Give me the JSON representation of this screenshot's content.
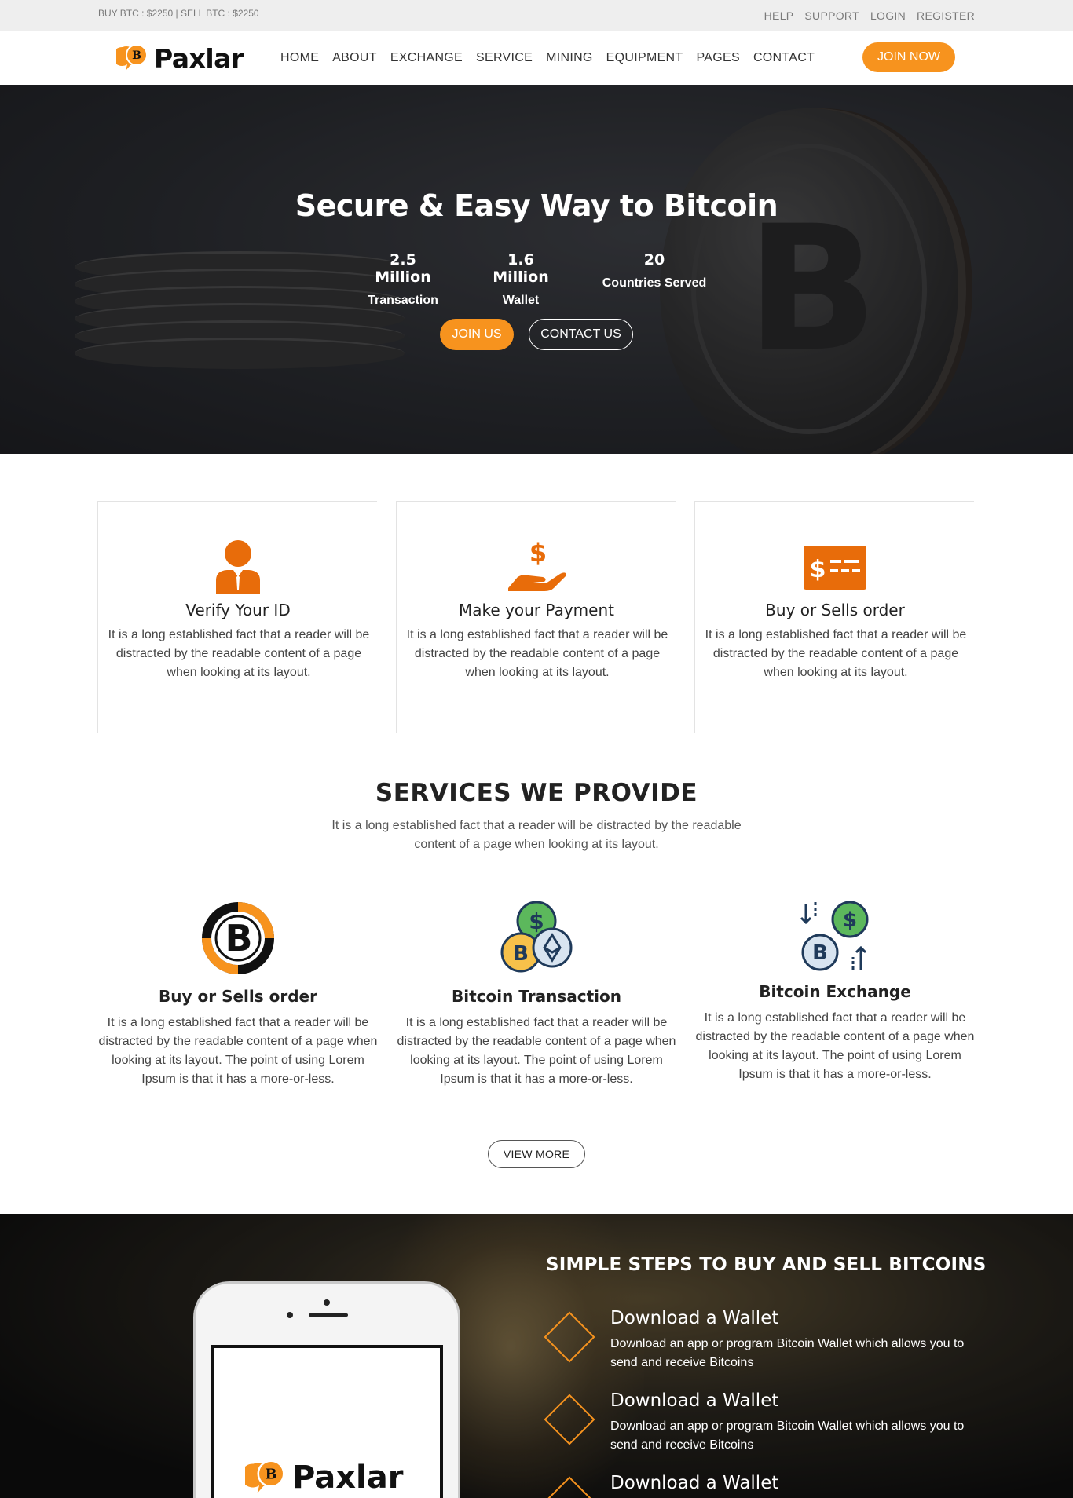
{
  "topbar": {
    "prices": "BUY BTC : $2250 | SELL BTC : $2250",
    "links": [
      "HELP",
      "SUPPORT",
      "LOGIN",
      "REGISTER"
    ]
  },
  "nav": {
    "logo_text": "Paxlar",
    "logo_letter": "B",
    "menu": [
      "HOME",
      "ABOUT",
      "EXCHANGE",
      "SERVICE",
      "MINING",
      "EQUIPMENT",
      "PAGES",
      "CONTACT"
    ],
    "cta": "JOIN NOW"
  },
  "hero": {
    "title": "Secure & Easy Way to Bitcoin",
    "stats": [
      {
        "value": "2.5 Million",
        "label": "Transaction"
      },
      {
        "value": "1.6 Million",
        "label": "Wallet"
      },
      {
        "value": "20",
        "label": "Countries Served"
      }
    ],
    "join_label": "JOIN US",
    "contact_label": "CONTACT US"
  },
  "features": [
    {
      "icon": "user-id-icon",
      "title": "Verify Your ID",
      "text": "It is a long established fact that a reader will be distracted by the readable content of a page when looking at its layout."
    },
    {
      "icon": "payment-hand-icon",
      "title": "Make your Payment",
      "text": "It is a long established fact that a reader will be distracted by the readable content of a page when looking at its layout."
    },
    {
      "icon": "dollar-card-icon",
      "title": "Buy or Sells order",
      "text": "It is a long established fact that a reader will be distracted by the readable content of a page when looking at its layout."
    }
  ],
  "services": {
    "title": "SERVICES WE PROVIDE",
    "subtitle": "It is a long established fact that a reader will be distracted by the readable content of a page when looking at its layout.",
    "items": [
      {
        "icon": "bitcoin-coin-icon",
        "title": "Buy or Sells order",
        "text": "It is a long established fact that a reader will be distracted by the readable content of a page when looking at its layout. The point of using Lorem Ipsum is that it has a more-or-less."
      },
      {
        "icon": "coins-stack-icon",
        "title": "Bitcoin Transaction",
        "text": "It is a long established fact that a reader will be distracted by the readable content of a page when looking at its layout. The point of using Lorem Ipsum is that it has a more-or-less."
      },
      {
        "icon": "exchange-icon",
        "title": "Bitcoin Exchange",
        "text": "It is a long established fact that a reader will be distracted by the readable content of a page when looking at its layout. The point of using Lorem Ipsum is that it has a more-or-less."
      }
    ],
    "view_more": "VIEW MORE"
  },
  "steps": {
    "title": "SIMPLE STEPS TO BUY AND SELL BITCOINS",
    "phone_logo": "Paxlar",
    "items": [
      {
        "title": "Download a Wallet",
        "text": "Download an app or program Bitcoin Wallet which allows you to send and receive Bitcoins"
      },
      {
        "title": "Download a Wallet",
        "text": "Download an app or program Bitcoin Wallet which allows you to send and receive Bitcoins"
      },
      {
        "title": "Download a Wallet",
        "text": ""
      }
    ]
  },
  "colors": {
    "accent": "#f7931e",
    "icon_orange": "#e86c0a",
    "dark": "#222222"
  }
}
